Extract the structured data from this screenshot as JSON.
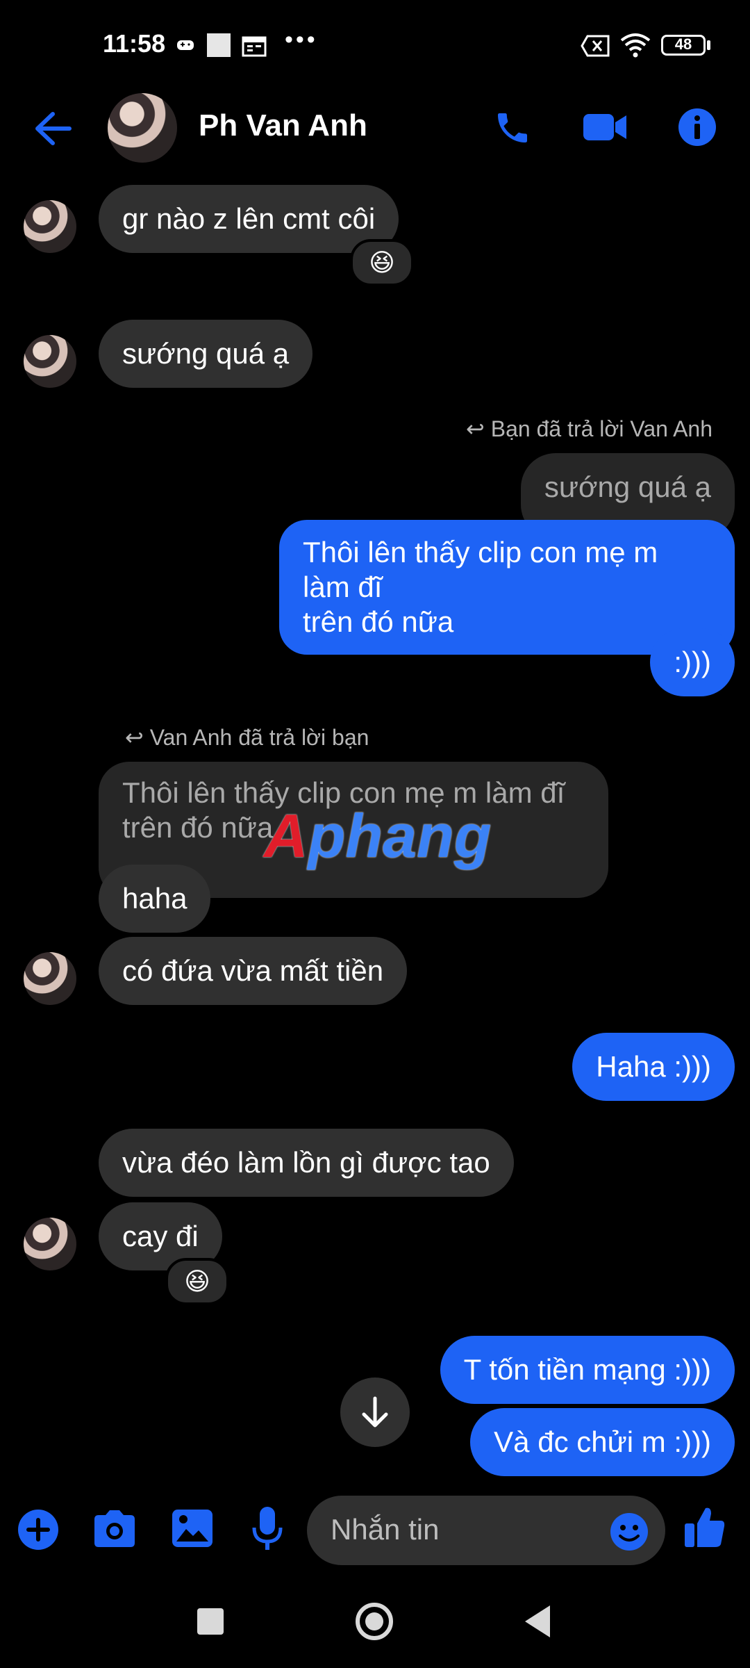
{
  "status_bar": {
    "time": "11:58",
    "battery": "48"
  },
  "header": {
    "contact_name": "Ph Van Anh"
  },
  "messages": {
    "m1": "gr nào z lên cmt côi",
    "m1_reaction": "😆",
    "m2": "sướng quá ạ",
    "reply_hint_1": "Bạn đã trả lời Van Anh",
    "quote_1": "sướng quá ạ",
    "m3_line1": "Thôi lên thấy clip con mẹ m làm đĩ",
    "m3_line2": "trên đó nữa",
    "m4": ":)))",
    "reply_hint_2": "Van Anh đã trả lời bạn",
    "quote_2_line1": "Thôi lên thấy clip con mẹ m làm đĩ",
    "quote_2_line2": "trên đó nữa",
    "m5": "haha",
    "m6": "có đứa vừa mất tiền",
    "m7": "Haha :)))",
    "m8": "vừa đéo làm lồn gì được tao",
    "m9": "cay đi",
    "m9_reaction": "😆",
    "m10": "T tốn tiền mạng :)))",
    "m11": "Và đc chửi m :)))"
  },
  "composer": {
    "placeholder": "Nhắn tin"
  },
  "watermark": {
    "first": "A",
    "rest": "phang"
  },
  "colors": {
    "accent": "#1e63f5",
    "received_bubble": "#303030",
    "background": "#000000"
  }
}
